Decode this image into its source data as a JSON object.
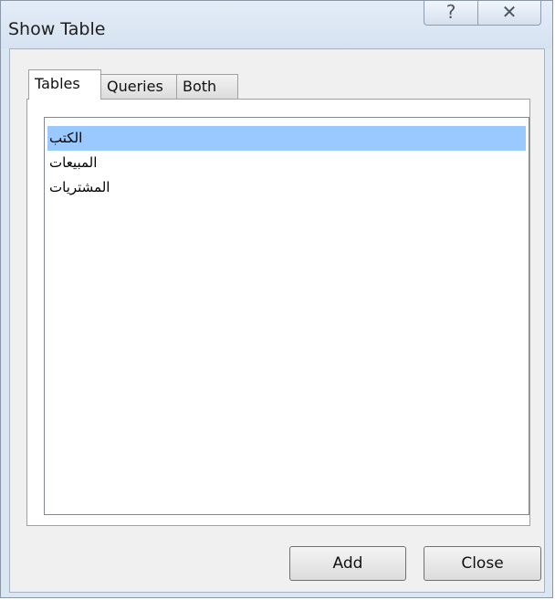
{
  "window": {
    "title": "Show Table",
    "help_glyph": "?",
    "close_glyph": "✕"
  },
  "tabs": [
    {
      "label": "Tables",
      "active": true
    },
    {
      "label": "Queries",
      "active": false
    },
    {
      "label": "Both",
      "active": false
    }
  ],
  "list": {
    "items": [
      {
        "label": "الكتب",
        "selected": true
      },
      {
        "label": "المبيعات",
        "selected": false
      },
      {
        "label": "المشتريات",
        "selected": false
      }
    ]
  },
  "buttons": {
    "add_label": "Add",
    "close_label": "Close"
  },
  "colors": {
    "selection": "#99c9ff",
    "frame": "#dbe6f3"
  }
}
